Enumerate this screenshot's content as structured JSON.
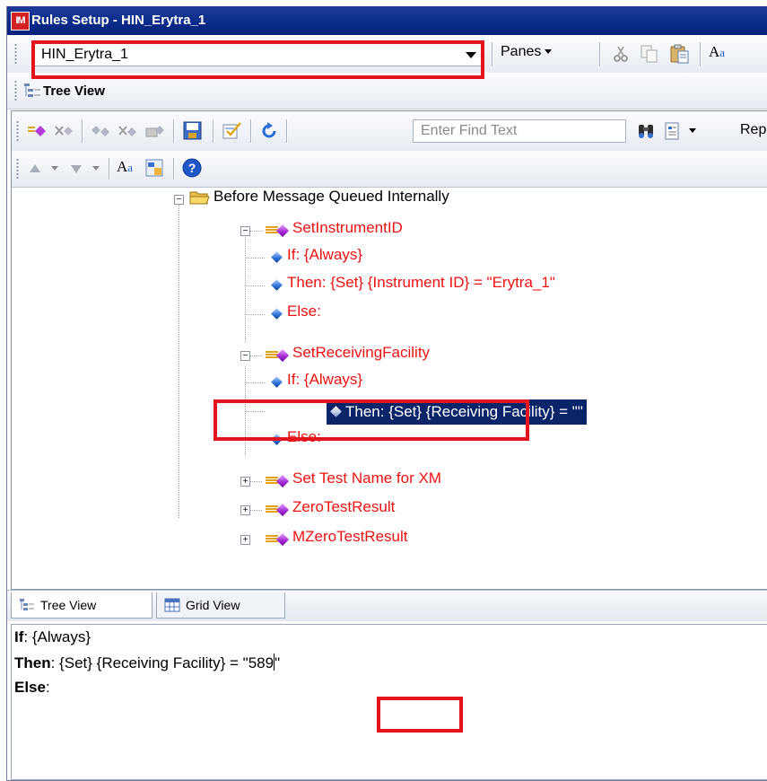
{
  "window": {
    "app_icon_text": "IM",
    "title": "Rules Setup - HIN_Erytra_1"
  },
  "toolbar": {
    "ruleset_value": "HIN_Erytra_1",
    "panes_label": "Panes",
    "tree_view_label": "Tree View"
  },
  "inner_toolbar": {
    "find_placeholder": "Enter Find Text",
    "rep_label": "Rep"
  },
  "tree": {
    "root": "Before Message Queued Internally",
    "rule1": {
      "name": "SetInstrumentID",
      "if": "If: {Always}",
      "then": "Then: {Set} {Instrument ID} = \"Erytra_1\"",
      "else": "Else:"
    },
    "rule2": {
      "name": "SetReceivingFacility",
      "if": "If: {Always}",
      "then": "Then: {Set} {Receiving Facility} = \"\"",
      "else": "Else:"
    },
    "rule3": "Set Test Name for XM",
    "rule4": "ZeroTestResult",
    "rule5": "MZeroTestResult"
  },
  "tabs": {
    "tree_view": "Tree View",
    "grid_view": "Grid View"
  },
  "editor": {
    "if_kw": "If",
    "if_rest": ": {Always}",
    "then_kw": "Then",
    "then_rest": ": {Set} {Receiving Facility} = ",
    "value": "\"589",
    "value_close": "\"",
    "else_kw": "Else",
    "else_rest": ":"
  },
  "colors": {
    "titlebar": "#0a2a88",
    "rule_text": "#ee1111",
    "selection": "#0a246a",
    "highlight_box": "#e4141c"
  }
}
